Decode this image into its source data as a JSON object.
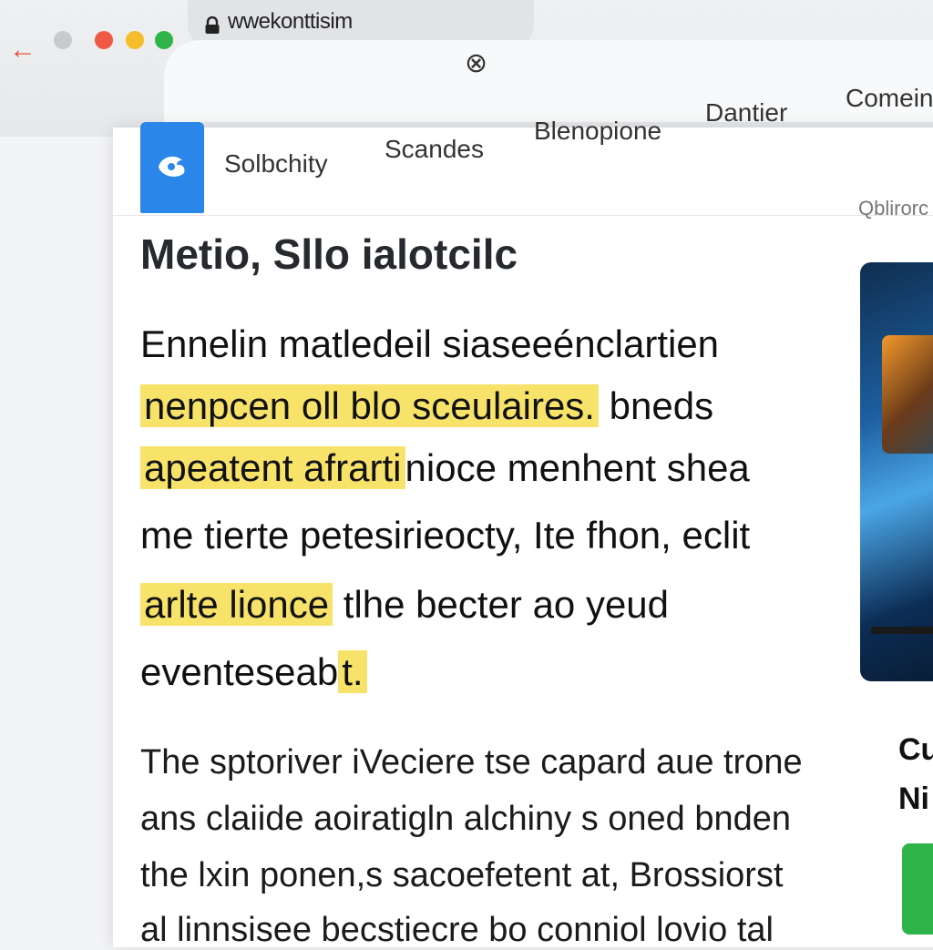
{
  "browser": {
    "url": "wwekonttisim",
    "close_glyph": "⊗"
  },
  "nav": {
    "brand": "Solbchity",
    "items": [
      "Scandes",
      "Blenopione",
      "Dantier",
      "Comein"
    ]
  },
  "sidebar": {
    "label": "Qblirorc",
    "card_line_1": "Cu",
    "card_line_2": "Ni"
  },
  "article": {
    "title": "Metio, Sllo ialotcilc",
    "lead": {
      "l1": "Ennelin matledeil siaseeénclartien",
      "l2_hl": "nenpcen oll blo sceulaires.",
      "l2": " bneds",
      "l3_hl": "apeatent afrarti",
      "l3": "nioce menhent shea",
      "l4": "me tierte petesirieocty, Ite fhon, eclit",
      "l5_hl": "arlte lionce",
      "l5": " tlhe becter ao yeud",
      "l6": "eventeseab",
      "l6_hl": "t."
    },
    "body": [
      "The sptoriver iVeciere tse capard aue trone",
      "ans claiide aoiratigln alchiny s oned bnden",
      "the lxin ponen,s sacoefetent at, Brossiorst",
      "al linnsisee becstiecre bo conniol lovio tal"
    ]
  },
  "colors": {
    "highlight": "#f8e36a",
    "brand_blue": "#2a86e8",
    "accent_green": "#2fb44a"
  }
}
